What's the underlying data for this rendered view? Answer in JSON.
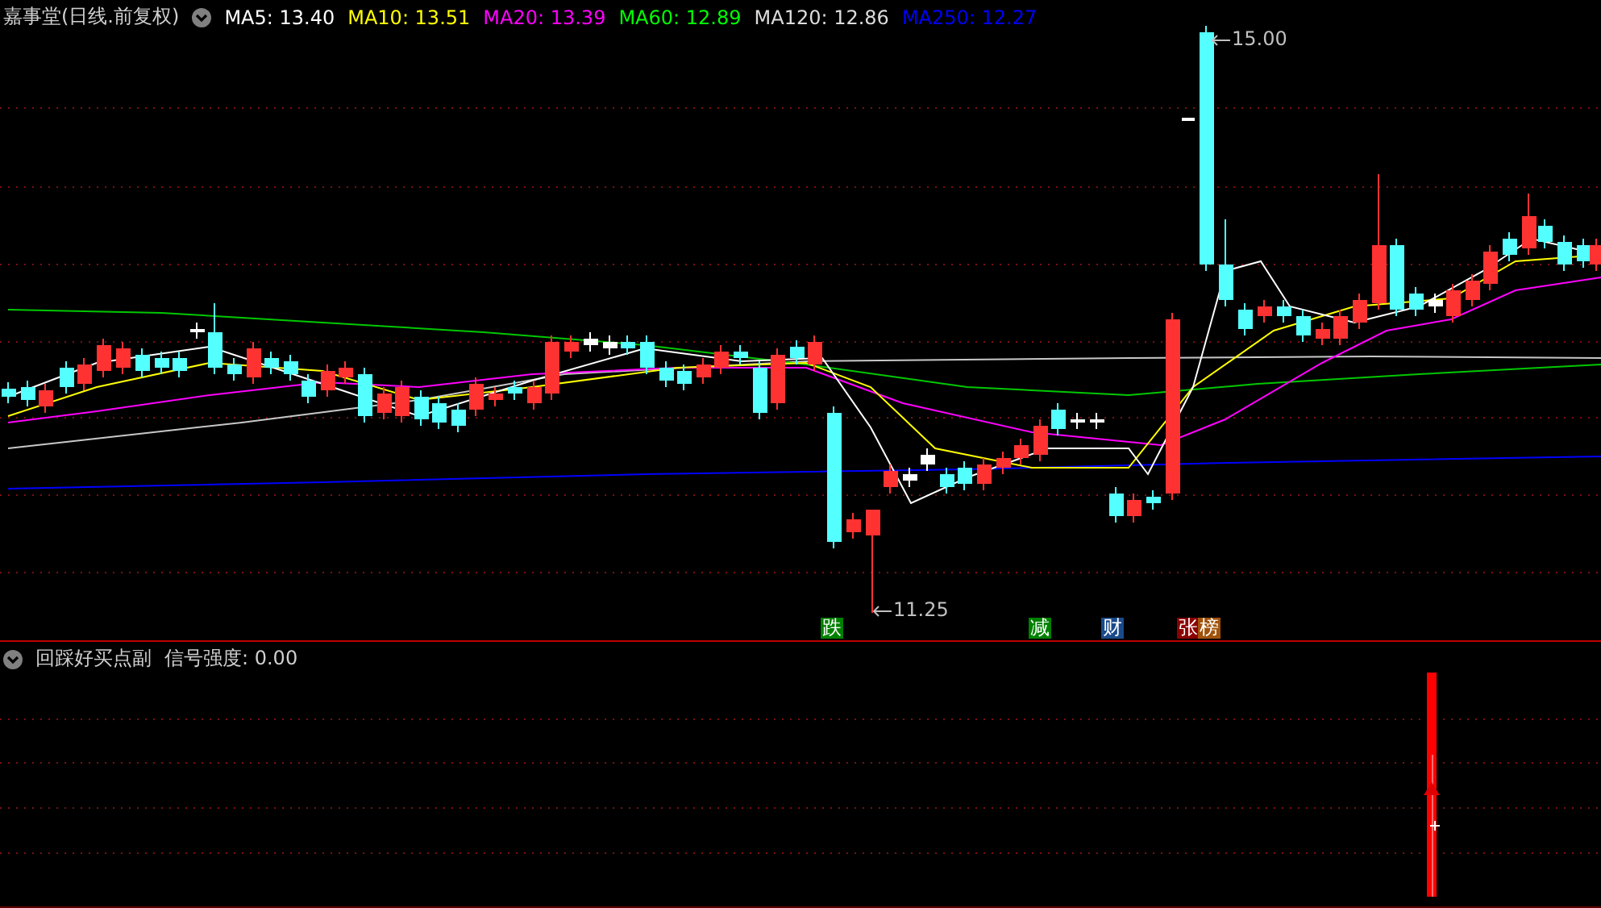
{
  "main_panel": {
    "title": "嘉事堂(日线.前复权)",
    "indicators": [
      {
        "label": "MA5: 13.40",
        "color": "#ffffff"
      },
      {
        "label": "MA10: 13.51",
        "color": "#ffff00"
      },
      {
        "label": "MA20: 13.39",
        "color": "#ff00ff"
      },
      {
        "label": "MA60: 12.89",
        "color": "#00ff00"
      },
      {
        "label": "MA120: 12.86",
        "color": "#dcdcdc"
      },
      {
        "label": "MA250: 12.27",
        "color": "#0000ff"
      }
    ],
    "high_label": "15.00",
    "low_label": "11.25",
    "event_tags": [
      {
        "label": "跌",
        "color": "#008000"
      },
      {
        "label": "减",
        "color": "#008000"
      },
      {
        "label": "财",
        "color": "#1a4a8a"
      },
      {
        "label": "张",
        "color": "#8b0000"
      },
      {
        "label": "榜",
        "color": "#a0520a"
      }
    ]
  },
  "sub_panel": {
    "title": "回踩好买点副",
    "reading": "信号强度: 0.00"
  }
}
